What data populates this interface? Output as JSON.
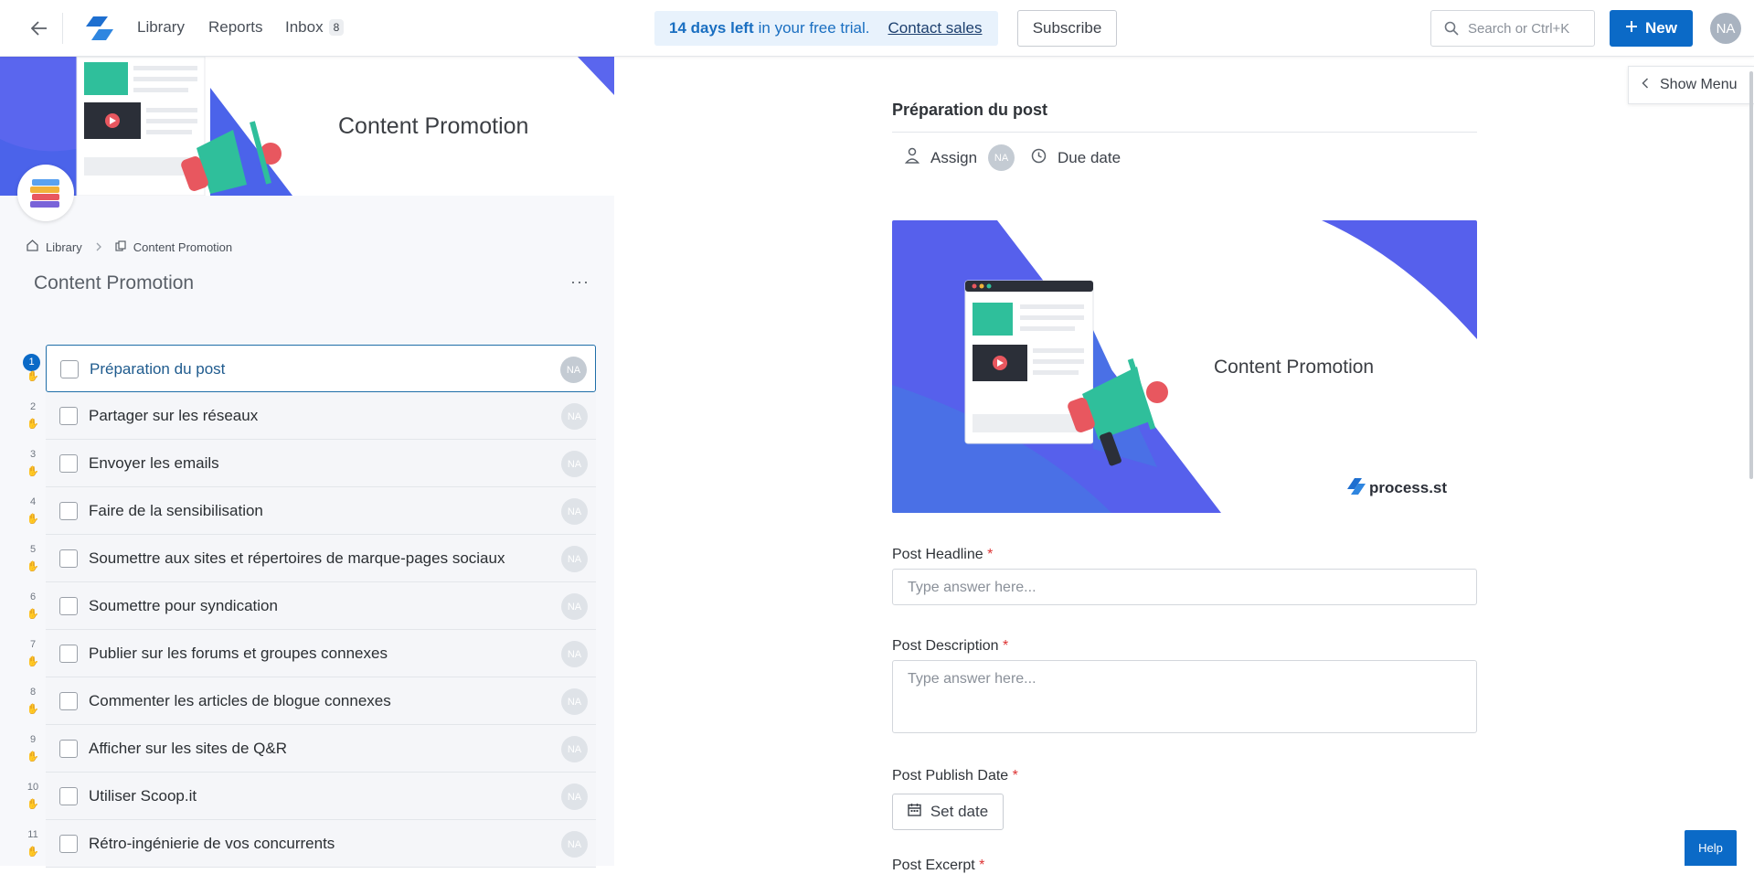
{
  "topbar": {
    "nav": {
      "library": "Library",
      "reports": "Reports",
      "inbox": "Inbox",
      "inbox_count": "8"
    },
    "trial": {
      "bold": "14 days left",
      "rest": "in your free trial.",
      "link": "Contact sales"
    },
    "subscribe": "Subscribe",
    "search_placeholder": "Search or Ctrl+K",
    "new_label": "New",
    "avatar_initials": "NA"
  },
  "left": {
    "banner_title": "Content Promotion",
    "breadcrumb": {
      "root": "Library",
      "current": "Content Promotion"
    },
    "title": "Content Promotion",
    "more": "···",
    "tasks": [
      {
        "num": "1",
        "label": "Préparation du post",
        "assignee": "NA"
      },
      {
        "num": "2",
        "label": "Partager sur les réseaux",
        "assignee": "NA"
      },
      {
        "num": "3",
        "label": "Envoyer les emails",
        "assignee": "NA"
      },
      {
        "num": "4",
        "label": "Faire de la sensibilisation",
        "assignee": "NA"
      },
      {
        "num": "5",
        "label": "Soumettre aux sites et répertoires de marque-pages sociaux",
        "assignee": "NA"
      },
      {
        "num": "6",
        "label": "Soumettre pour syndication",
        "assignee": "NA"
      },
      {
        "num": "7",
        "label": "Publier sur les forums et groupes connexes",
        "assignee": "NA"
      },
      {
        "num": "8",
        "label": "Commenter les articles de blogue connexes",
        "assignee": "NA"
      },
      {
        "num": "9",
        "label": "Afficher sur les sites de Q&R",
        "assignee": "NA"
      },
      {
        "num": "10",
        "label": "Utiliser Scoop.it",
        "assignee": "NA"
      },
      {
        "num": "11",
        "label": "Rétro-ingénierie de vos concurrents",
        "assignee": "NA"
      }
    ]
  },
  "main": {
    "task_title": "Préparation du post",
    "assign_label": "Assign",
    "assignee": "NA",
    "due_label": "Due date",
    "hero_title": "Content Promotion",
    "hero_brand": "process.st",
    "fields": {
      "headline": {
        "label": "Post Headline",
        "required": "*",
        "placeholder": "Type answer here..."
      },
      "description": {
        "label": "Post Description",
        "required": "*",
        "placeholder": "Type answer here..."
      },
      "publish_date": {
        "label": "Post Publish Date",
        "required": "*",
        "button": "Set date"
      },
      "excerpt": {
        "label": "Post Excerpt",
        "required": "*"
      }
    }
  },
  "show_menu": "Show Menu",
  "help": "Help",
  "colors": {
    "accent": "#0b6ac7",
    "trial_bg": "#e8f2fc",
    "required": "#dd3333"
  }
}
